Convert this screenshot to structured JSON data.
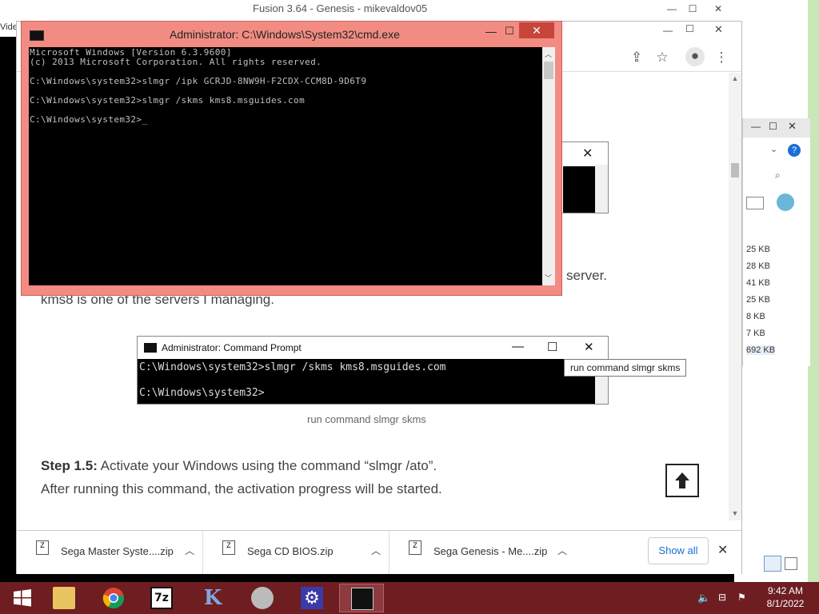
{
  "colors": {
    "taskbar": "#6e1d21",
    "cmd_frame": "#f28c82",
    "cmd_close": "#c7463c",
    "link_blue": "#1a6fd6"
  },
  "desktop": {
    "left_fragment": "Vide"
  },
  "fusion_window": {
    "title": "Fusion 3.64 - Genesis - mikevaldov05"
  },
  "cmd_window": {
    "title": "Administrator: C:\\Windows\\System32\\cmd.exe",
    "lines": [
      "Microsoft Windows [Version 6.3.9600]",
      "(c) 2013 Microsoft Corporation. All rights reserved.",
      "",
      "C:\\Windows\\system32>slmgr /ipk GCRJD-8NW9H-F2CDX-CCM8D-9D6T9",
      "",
      "C:\\Windows\\system32>slmgr /skms kms8.msguides.com",
      "",
      "C:\\Windows\\system32>_"
    ]
  },
  "article": {
    "partial_line_1": "server.",
    "partial_line_2": "kms8 is one of the servers I managing.",
    "embedded_cmd": {
      "title": "Administrator: Command Prompt",
      "line1": "C:\\Windows\\system32>slmgr /skms kms8.msguides.com",
      "line2": "C:\\Windows\\system32>"
    },
    "tooltip": "run command slmgr skms",
    "caption": "run command slmgr skms",
    "step_label": "Step 1.5:",
    "step_text": " Activate your Windows using the command “slmgr /ato”.",
    "step_text_2": "After running this command, the activation progress will be started."
  },
  "downloads": {
    "items": [
      {
        "name": "Sega Master Syste....zip"
      },
      {
        "name": "Sega CD BIOS.zip"
      },
      {
        "name": "Sega Genesis - Me....zip"
      }
    ],
    "show_all": "Show all"
  },
  "explorer": {
    "sizes": [
      "25 KB",
      "28 KB",
      "41 KB",
      "25 KB",
      "8 KB",
      "7 KB",
      "692 KB"
    ]
  },
  "taskbar": {
    "time": "9:42 AM",
    "date": "8/1/2022"
  }
}
